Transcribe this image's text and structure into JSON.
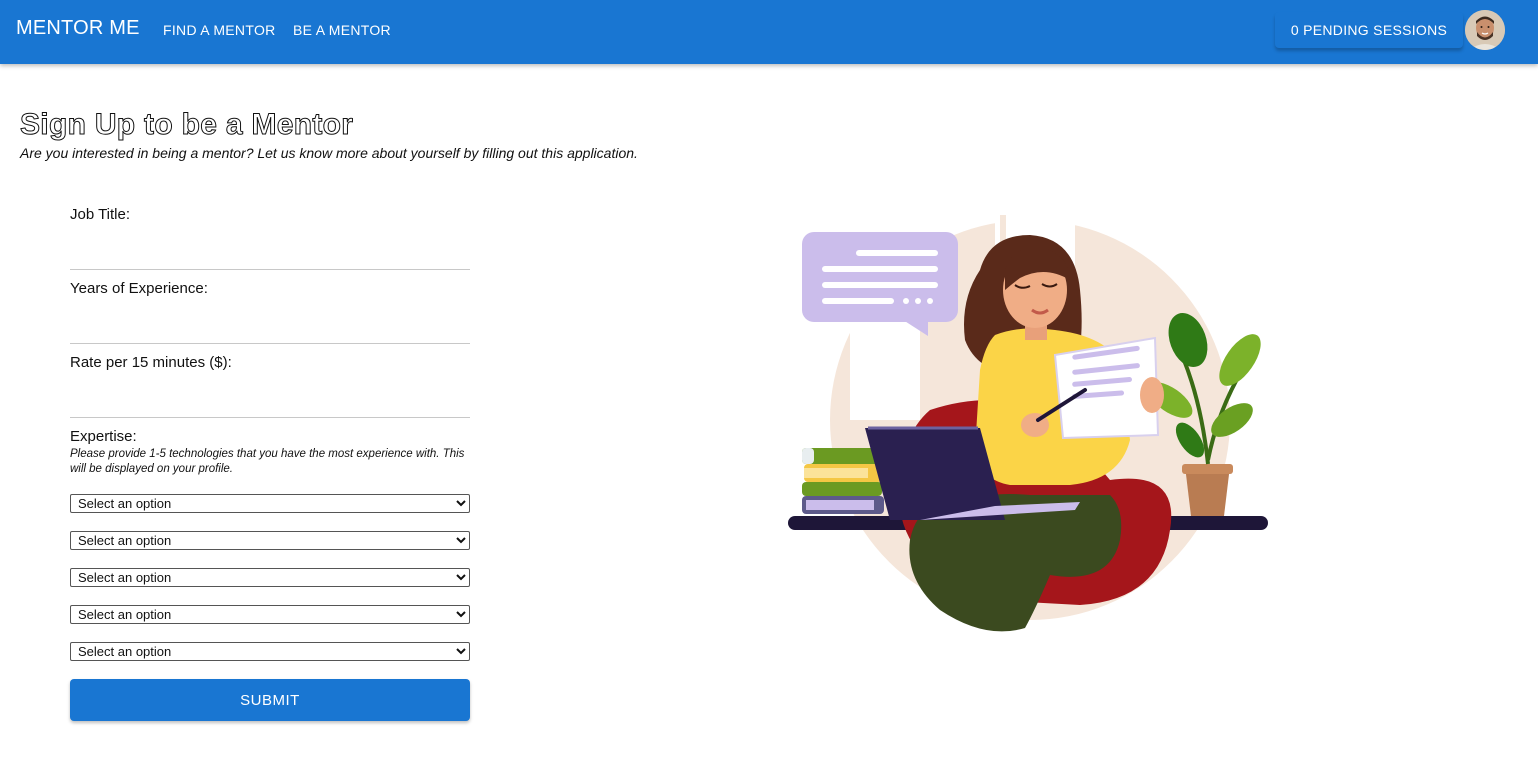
{
  "header": {
    "brand": "MENTOR ME",
    "nav": [
      {
        "label": "FIND A MENTOR"
      },
      {
        "label": "BE A MENTOR"
      }
    ],
    "pending_sessions": "0 PENDING SESSIONS"
  },
  "page": {
    "title": "Sign Up to be a Mentor",
    "subtitle": "Are you interested in being a mentor? Let us know more about yourself by filling out this application."
  },
  "form": {
    "job_title_label": "Job Title:",
    "years_label": "Years of Experience:",
    "rate_label": "Rate per 15 minutes ($):",
    "expertise_label": "Expertise:",
    "expertise_help": "Please provide 1-5 technologies that you have the most experience with. This will be displayed on your profile.",
    "select_placeholder": "Select an option",
    "submit_label": "SUBMIT"
  },
  "colors": {
    "primary": "#1976d2",
    "illustration_bg": "#f5e6da",
    "chat_bubble": "#cbbdeb",
    "shirt": "#fbd447",
    "pants": "#3b4a1f",
    "chair": "#a5161b"
  }
}
